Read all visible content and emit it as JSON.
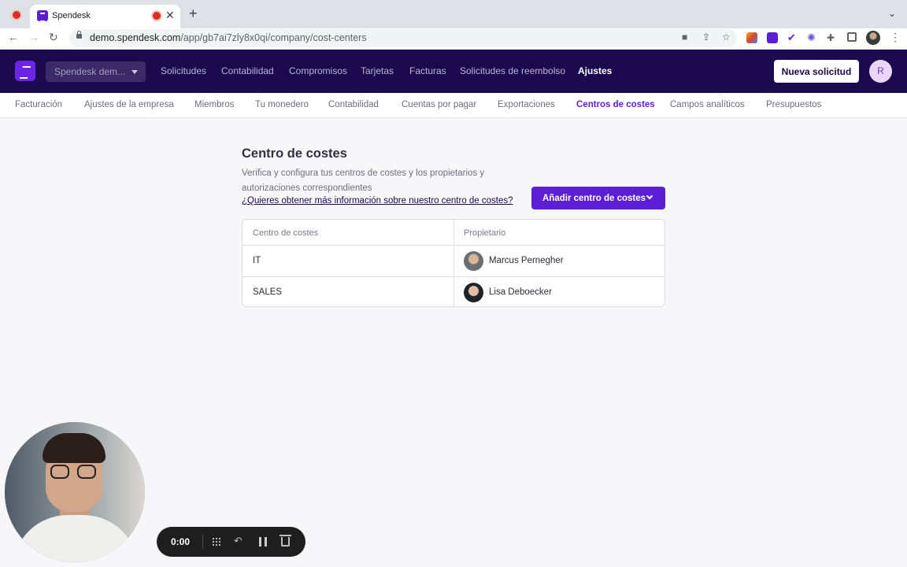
{
  "browser": {
    "tab_title": "Spendesk",
    "tab_close": "✕",
    "new_tab": "+",
    "url_domain": "demo.spendesk.com",
    "url_path": "/app/gb7ai7zly8x0qi/company/cost-centers"
  },
  "header": {
    "company_select": "Spendesk dem...",
    "nav": [
      {
        "label": "Solicitudes"
      },
      {
        "label": "Contabilidad"
      },
      {
        "label": "Compromisos"
      },
      {
        "label": "Tarjetas"
      },
      {
        "label": "Facturas"
      },
      {
        "label": "Solicitudes de reembolso"
      },
      {
        "label": "Ajustes",
        "active": true
      }
    ],
    "new_request_label": "Nueva solicitud",
    "user_initial": "R"
  },
  "subnav": {
    "items": [
      {
        "label": "Facturación"
      },
      {
        "label": "Ajustes de la empresa"
      },
      {
        "label": "Miembros"
      },
      {
        "label": "Tu monedero"
      },
      {
        "label": "Contabilidad"
      },
      {
        "label": "Cuentas por pagar"
      },
      {
        "label": "Exportaciones"
      },
      {
        "label": "Centros de costes",
        "active": true
      },
      {
        "label": "Campos analíticos"
      },
      {
        "label": "Presupuestos"
      }
    ]
  },
  "main": {
    "title": "Centro de costes",
    "description": "Verifica y configura tus centros de costes y los propietarios y autorizaciones correspondientes",
    "info_link": "¿Quieres obtener más información sobre nuestro centro de costes?",
    "add_button_label": "Añadir centro de costes",
    "table": {
      "columns": [
        "Centro de costes",
        "Propietario"
      ],
      "rows": [
        {
          "cost_center": "IT",
          "owner": "Marcus Pernegher"
        },
        {
          "cost_center": "SALES",
          "owner": "Lisa Deboecker"
        }
      ]
    }
  },
  "recorder": {
    "time": "0:00"
  },
  "colors": {
    "brand_dark": "#1c0a4e",
    "brand_purple": "#5d1fd5"
  }
}
